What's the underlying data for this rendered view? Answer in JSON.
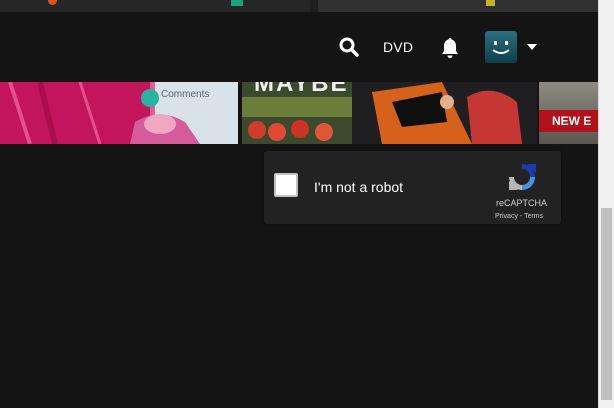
{
  "header": {
    "dvd_label": "DVD",
    "icons": {
      "search": "search-icon",
      "notifications": "bell-icon",
      "profile_caret": "caret-down-icon"
    }
  },
  "rows": {
    "thumbnails": [
      {
        "text": "Comments"
      },
      {
        "text": "MAYBE"
      },
      {
        "text": "NEW E"
      }
    ]
  },
  "recaptcha": {
    "label": "I'm not a robot",
    "brand": "reCAPTCHA",
    "privacy": "Privacy",
    "separator": " - ",
    "terms": "Terms",
    "checked": false
  },
  "colors": {
    "background": "#141414",
    "text": "#ffffff",
    "recaptcha_bg": "#222222",
    "badge_red": "#b0111a"
  }
}
